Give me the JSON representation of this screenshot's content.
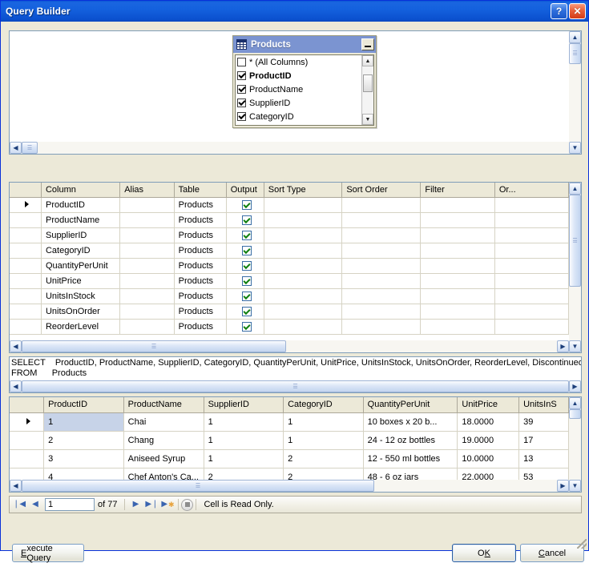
{
  "window": {
    "title": "Query Builder",
    "help_button": "?",
    "close_button": "✕"
  },
  "diagram": {
    "table_box": {
      "title": "Products",
      "minimize_label": "",
      "columns": [
        {
          "label": "* (All Columns)",
          "checked": false,
          "primary_key": false
        },
        {
          "label": "ProductID",
          "checked": true,
          "primary_key": true
        },
        {
          "label": "ProductName",
          "checked": true,
          "primary_key": false
        },
        {
          "label": "SupplierID",
          "checked": true,
          "primary_key": false
        },
        {
          "label": "CategoryID",
          "checked": true,
          "primary_key": false
        }
      ],
      "scroll_up": "▲",
      "scroll_down": "▼"
    }
  },
  "criteria_grid": {
    "headers": [
      "Column",
      "Alias",
      "Table",
      "Output",
      "Sort Type",
      "Sort Order",
      "Filter",
      "Or..."
    ],
    "rows": [
      {
        "column": "ProductID",
        "alias": "",
        "table": "Products",
        "output": true,
        "sort_type": "",
        "sort_order": "",
        "filter": "",
        "or": "",
        "selected": true
      },
      {
        "column": "ProductName",
        "alias": "",
        "table": "Products",
        "output": true,
        "sort_type": "",
        "sort_order": "",
        "filter": "",
        "or": "",
        "selected": false
      },
      {
        "column": "SupplierID",
        "alias": "",
        "table": "Products",
        "output": true,
        "sort_type": "",
        "sort_order": "",
        "filter": "",
        "or": "",
        "selected": false
      },
      {
        "column": "CategoryID",
        "alias": "",
        "table": "Products",
        "output": true,
        "sort_type": "",
        "sort_order": "",
        "filter": "",
        "or": "",
        "selected": false
      },
      {
        "column": "QuantityPerUnit",
        "alias": "",
        "table": "Products",
        "output": true,
        "sort_type": "",
        "sort_order": "",
        "filter": "",
        "or": "",
        "selected": false
      },
      {
        "column": "UnitPrice",
        "alias": "",
        "table": "Products",
        "output": true,
        "sort_type": "",
        "sort_order": "",
        "filter": "",
        "or": "",
        "selected": false
      },
      {
        "column": "UnitsInStock",
        "alias": "",
        "table": "Products",
        "output": true,
        "sort_type": "",
        "sort_order": "",
        "filter": "",
        "or": "",
        "selected": false
      },
      {
        "column": "UnitsOnOrder",
        "alias": "",
        "table": "Products",
        "output": true,
        "sort_type": "",
        "sort_order": "",
        "filter": "",
        "or": "",
        "selected": false
      },
      {
        "column": "ReorderLevel",
        "alias": "",
        "table": "Products",
        "output": true,
        "sort_type": "",
        "sort_order": "",
        "filter": "",
        "or": "",
        "selected": false
      }
    ]
  },
  "sql": {
    "text": "SELECT    ProductID, ProductName, SupplierID, CategoryID, QuantityPerUnit, UnitPrice, UnitsInStock, UnitsOnOrder, ReorderLevel, Discontinued\nFROM      Products"
  },
  "results": {
    "headers": [
      "ProductID",
      "ProductName",
      "SupplierID",
      "CategoryID",
      "QuantityPerUnit",
      "UnitPrice",
      "UnitsInS"
    ],
    "rows": [
      {
        "cells": [
          "1",
          "Chai",
          "1",
          "1",
          "10 boxes x 20 b...",
          "18.0000",
          "39"
        ],
        "selected": true
      },
      {
        "cells": [
          "2",
          "Chang",
          "1",
          "1",
          "24 - 12 oz bottles",
          "19.0000",
          "17"
        ],
        "selected": false
      },
      {
        "cells": [
          "3",
          "Aniseed Syrup",
          "1",
          "2",
          "12 - 550 ml bottles",
          "10.0000",
          "13"
        ],
        "selected": false
      },
      {
        "cells": [
          "4",
          "Chef Anton's Ca...",
          "2",
          "2",
          "48 - 6 oz jars",
          "22.0000",
          "53"
        ],
        "selected": false
      }
    ]
  },
  "navigation": {
    "first_label": "❘◀",
    "prev_label": "◀",
    "current_record": "1",
    "total_label": "of 77",
    "next_label": "▶",
    "last_label": "▶❘",
    "new_label": "▶",
    "new_star": "✱",
    "stop_label": "",
    "status": "Cell is Read Only."
  },
  "buttons": {
    "execute": {
      "accel": "E",
      "rest": "xecute Query"
    },
    "ok": {
      "pre": "O",
      "accel": "K",
      "rest": ""
    },
    "cancel": {
      "accel": "C",
      "rest": "ancel"
    }
  }
}
